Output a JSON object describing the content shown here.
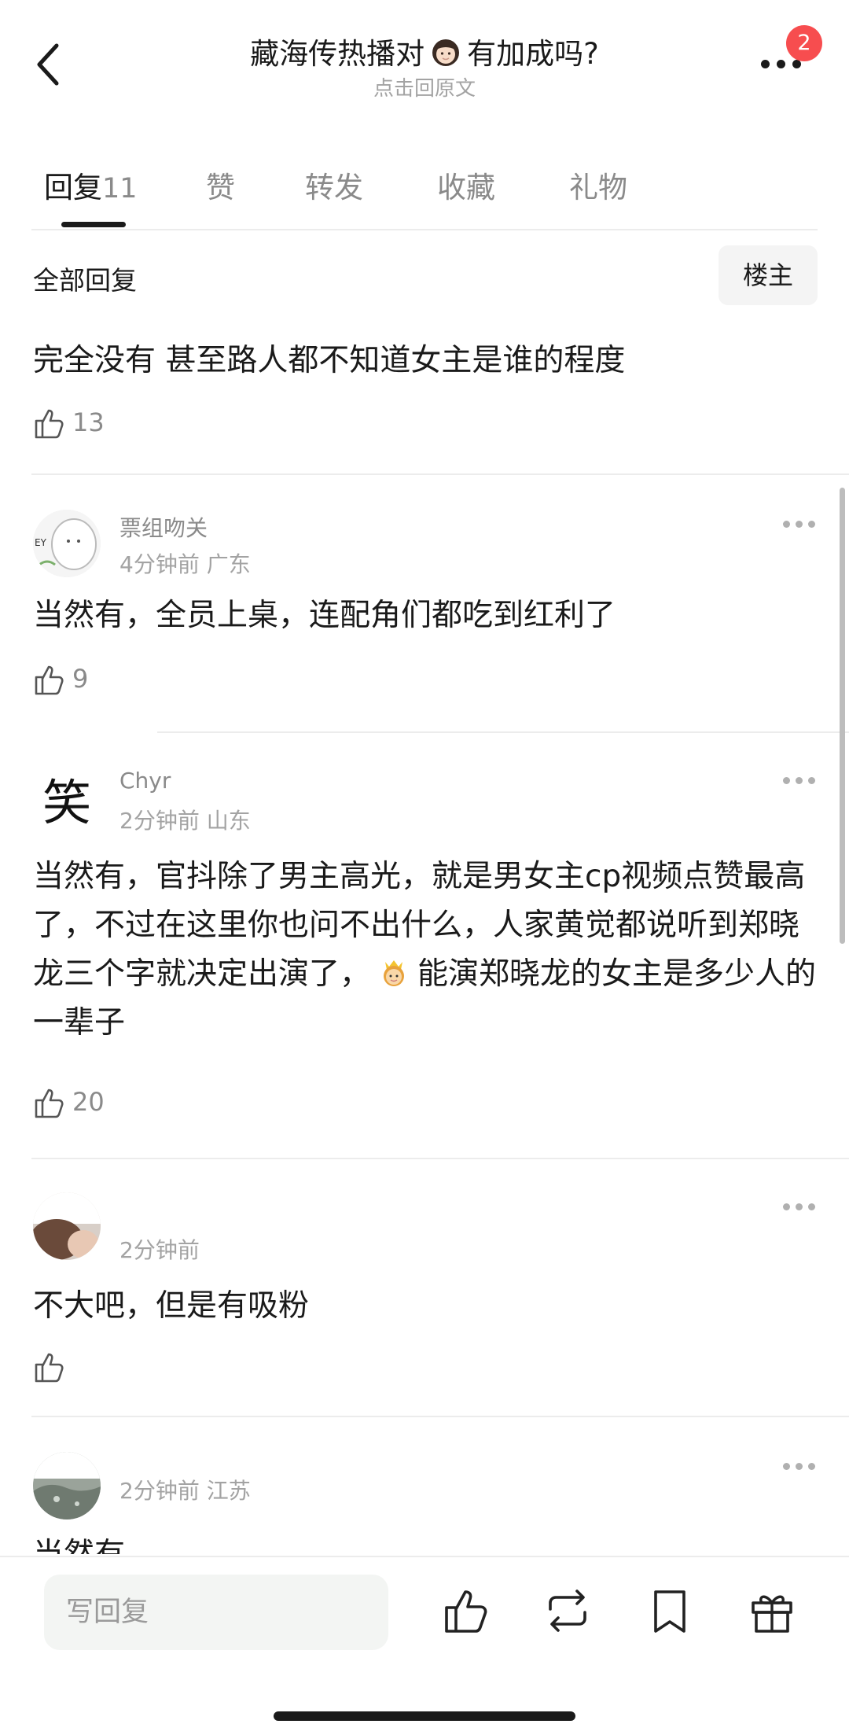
{
  "header": {
    "title_before": "藏海传热播对",
    "title_after": "有加成吗?",
    "title_emoji": "woman-emoji-icon",
    "subtitle": "点击回原文",
    "notification_count": "2"
  },
  "tabs": [
    {
      "label": "回复",
      "count": "11",
      "active": true
    },
    {
      "label": "赞"
    },
    {
      "label": "转发"
    },
    {
      "label": "收藏"
    },
    {
      "label": "礼物"
    }
  ],
  "section": {
    "title": "全部回复",
    "op_filter": "楼主"
  },
  "main_post": {
    "text": "完全没有 甚至路人都不知道女主是谁的程度",
    "likes": "13"
  },
  "comments": [
    {
      "username": "票组吻关",
      "time": "4分钟前",
      "location": "广东",
      "text": "当然有，全员上桌，连配角们都吃到红利了",
      "likes": "9"
    },
    {
      "username": "Chyr",
      "time": "2分钟前",
      "location": "山东",
      "avatar_char": "笑",
      "text_part1": "当然有，官抖除了男主高光，就是男女主cp视频点赞最高了，不过在这里你也问不出什么，人家黄觉都说听到郑晓龙三个字就决定出演了，",
      "text_emoji": "princess-emoji-icon",
      "text_part2": "能演郑晓龙的女主是多少人的一辈子",
      "likes": "20"
    },
    {
      "username": "",
      "time": "2分钟前",
      "location": "",
      "text": "不大吧，但是有吸粉",
      "likes": ""
    },
    {
      "username": "",
      "time": "2分钟前",
      "location": "江苏",
      "text": "当然有"
    }
  ],
  "bottom_bar": {
    "reply_placeholder": "写回复"
  },
  "colors": {
    "badge": "#f74d4f",
    "text_primary": "#1a1a1a",
    "text_secondary": "#8a8a8a",
    "divider": "#ececec"
  }
}
